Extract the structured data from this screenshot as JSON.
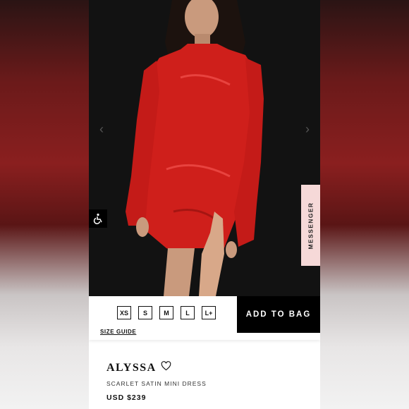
{
  "carousel": {
    "prev_icon": "chevron-left-icon",
    "next_icon": "chevron-right-icon"
  },
  "accessibility": {
    "icon": "wheelchair-icon"
  },
  "messenger": {
    "label": "MESSENGER"
  },
  "sizes": {
    "options": [
      "XS",
      "S",
      "M",
      "L",
      "L+"
    ],
    "guide_label": "SIZE GUIDE"
  },
  "cart": {
    "add_label": "ADD TO BAG"
  },
  "product": {
    "name": "ALYSSA",
    "wishlist_icon": "heart-icon",
    "subtitle": "SCARLET SATIN MINI DRESS",
    "price": "USD $239"
  },
  "colors": {
    "dress": "#d11f1c",
    "background": "#111111",
    "accent": "#000000",
    "messenger_tab": "#f6d9d8"
  }
}
